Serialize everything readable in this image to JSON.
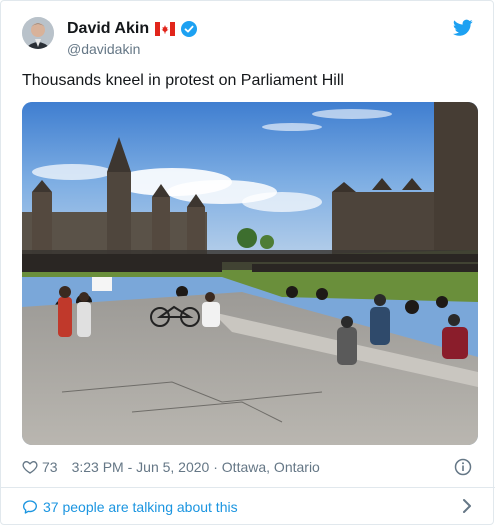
{
  "tweet": {
    "author_name": "David Akin",
    "handle": "@davidakin",
    "text": "Thousands kneel in protest on Parliament Hill",
    "likes": "73",
    "timestamp": "3:23 PM - Jun 5, 2020",
    "separator": " · ",
    "location": "Ottawa, Ontario",
    "talking": "37 people are talking about this"
  },
  "icons": {
    "flag": "canada-flag-icon",
    "verified": "verified-badge-icon",
    "brand": "twitter-bird-icon",
    "like": "heart-icon",
    "info": "info-icon",
    "reply": "speech-bubble-icon",
    "more": "chevron-right-icon"
  },
  "colors": {
    "accent": "#1b95e0",
    "brand": "#1da1f2",
    "muted": "#657786",
    "text": "#14171a",
    "flag_red": "#e1251b"
  }
}
